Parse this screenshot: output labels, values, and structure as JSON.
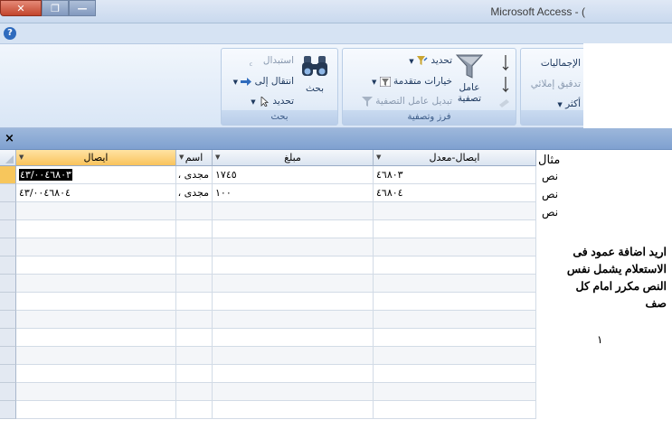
{
  "window": {
    "title": "Microsoft Access - (",
    "close_glyph": "✕",
    "restore_glyph": "❐",
    "minimize_glyph": "—"
  },
  "help": {
    "glyph": "?"
  },
  "ribbon": {
    "groups": [
      {
        "label": "بحث",
        "buttons": {
          "replace": "استبدال",
          "goto": "انتقال إلى",
          "select": "تحديد",
          "find": "بحث"
        }
      },
      {
        "label": "فرز وتصفية",
        "buttons": {
          "filter_line1": "عامل",
          "filter_line2": "تصفية",
          "selection": "تحديد",
          "advanced": "خيارات متقدمة",
          "toggle_filter": "تبديل عامل التصفية"
        }
      },
      {
        "label": "",
        "buttons": {
          "totals": "الإجماليات",
          "spelling": "تدقيق إملائي",
          "more": "أكثر"
        }
      }
    ]
  },
  "docbar": {
    "close_glyph": "×"
  },
  "datasheet": {
    "columns": [
      {
        "key": "receipt",
        "label": "ايصال"
      },
      {
        "key": "name",
        "label": "اسم"
      },
      {
        "key": "amount",
        "label": "مبلغ"
      },
      {
        "key": "receipt_mod",
        "label": "ايصال-معدل"
      }
    ],
    "rows": [
      {
        "receipt": "٤٣/٠٠٤٦٨٠٣",
        "name": "مجدى ،",
        "amount": "١٧٤٥",
        "receipt_mod": "٤٦٨٠٣"
      },
      {
        "receipt": "٤٣/٠٠٤٦٨٠٤",
        "name": "مجدى ،",
        "amount": "١٠٠",
        "receipt_mod": "٤٦٨٠٤"
      }
    ]
  },
  "example": {
    "heading": "مثال",
    "items": [
      "نص",
      "نص",
      "نص"
    ]
  },
  "note": {
    "line1": "اريد اضافة عمود فى",
    "line2": "الاستعلام يشمل نفس",
    "line3": "النص مكرر امام كل",
    "line4": "صف"
  },
  "counter": "١"
}
